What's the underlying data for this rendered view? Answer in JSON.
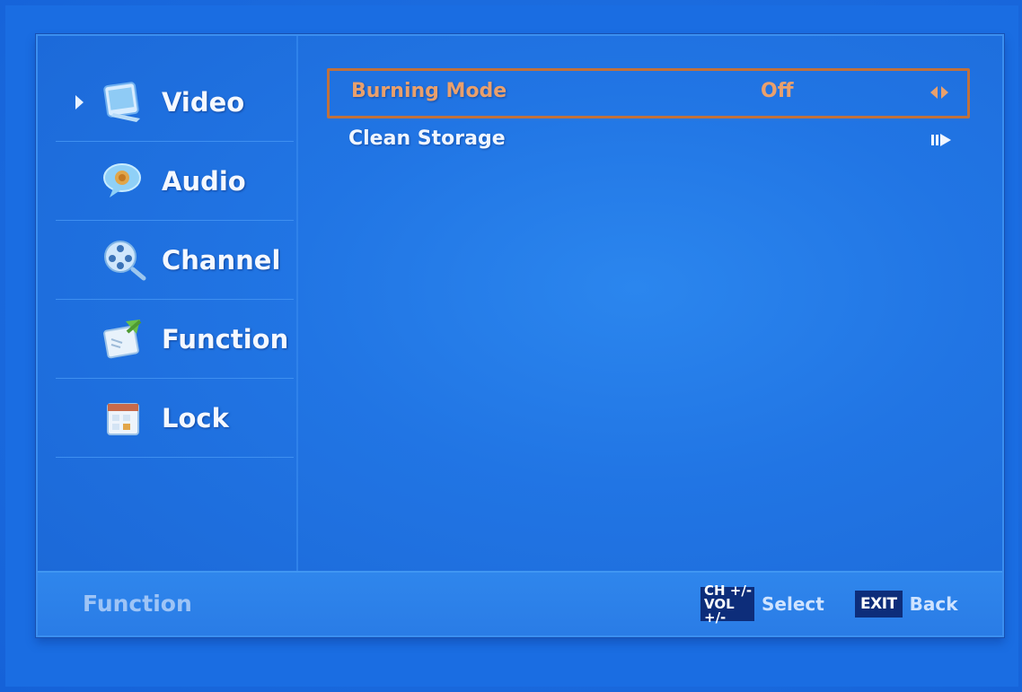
{
  "menu": {
    "items": [
      {
        "label": "Video",
        "icon": "video-icon",
        "active": true
      },
      {
        "label": "Audio",
        "icon": "audio-icon",
        "active": false
      },
      {
        "label": "Channel",
        "icon": "channel-icon",
        "active": false
      },
      {
        "label": "Function",
        "icon": "function-icon",
        "active": false
      },
      {
        "label": "Lock",
        "icon": "lock-icon",
        "active": false
      }
    ]
  },
  "settings": {
    "rows": [
      {
        "label": "Burning Mode",
        "value": "Off",
        "control": "left-right-arrows-icon",
        "selected": true
      },
      {
        "label": "Clean Storage",
        "value": "",
        "control": "enter-arrow-icon",
        "selected": false
      }
    ]
  },
  "footer": {
    "section": "Function",
    "keys": {
      "ch": "CH +/-",
      "vol": "VOL +/-",
      "select": "Select",
      "exit": "EXIT",
      "back": "Back"
    }
  },
  "colors": {
    "background": "#1d6ee0",
    "highlight": "#e9a06c",
    "text": "#f4f8ff"
  }
}
